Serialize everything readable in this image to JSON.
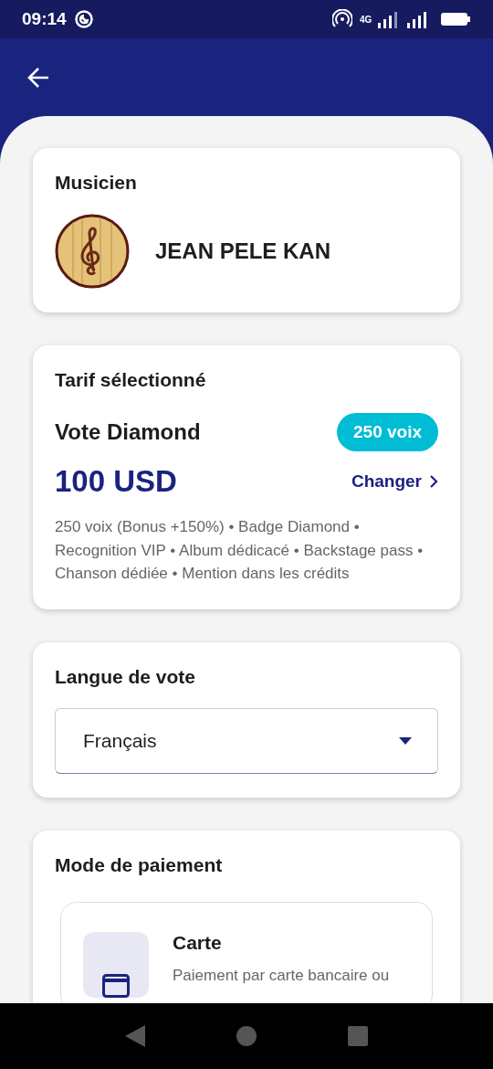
{
  "status_bar": {
    "time": "09:14",
    "network": "4G"
  },
  "musician": {
    "title": "Musicien",
    "name": "JEAN PELE KAN"
  },
  "tariff": {
    "title": "Tarif sélectionné",
    "plan": "Vote Diamond",
    "votes_badge": "250 voix",
    "price": "100 USD",
    "change_link": "Changer",
    "description": "250 voix (Bonus +150%) • Badge Diamond • Recognition VIP • Album dédicacé • Backstage pass • Chanson dédiée • Mention dans les crédits"
  },
  "language": {
    "title": "Langue de vote",
    "value": "Français"
  },
  "payment": {
    "title": "Mode de paiement",
    "options": [
      {
        "label": "Carte",
        "description": "Paiement par carte bancaire ou"
      }
    ]
  }
}
